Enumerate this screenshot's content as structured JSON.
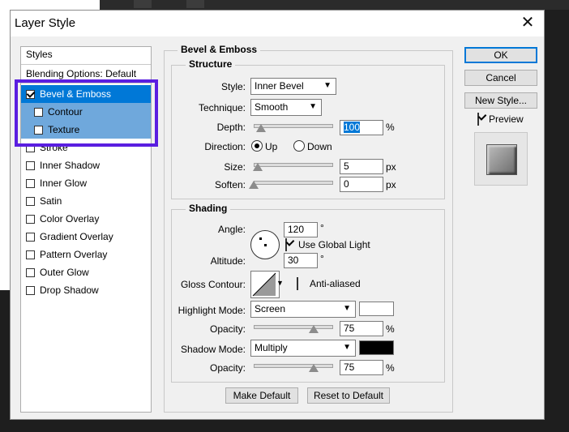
{
  "dialog": {
    "title": "Layer Style",
    "close_glyph": "✕"
  },
  "styles": {
    "header": "Styles",
    "blending": "Blending Options: Default",
    "items": [
      {
        "label": "Bevel & Emboss",
        "checked": true
      },
      {
        "label": "Contour",
        "checked": false
      },
      {
        "label": "Texture",
        "checked": false
      },
      {
        "label": "Stroke",
        "checked": false
      },
      {
        "label": "Inner Shadow",
        "checked": false
      },
      {
        "label": "Inner Glow",
        "checked": false
      },
      {
        "label": "Satin",
        "checked": false
      },
      {
        "label": "Color Overlay",
        "checked": false
      },
      {
        "label": "Gradient Overlay",
        "checked": false
      },
      {
        "label": "Pattern Overlay",
        "checked": false
      },
      {
        "label": "Outer Glow",
        "checked": false
      },
      {
        "label": "Drop Shadow",
        "checked": false
      }
    ]
  },
  "bevel": {
    "section_title": "Bevel & Emboss",
    "structure": {
      "title": "Structure",
      "style_label": "Style:",
      "style_value": "Inner Bevel",
      "technique_label": "Technique:",
      "technique_value": "Smooth",
      "depth_label": "Depth:",
      "depth_value": "100",
      "depth_unit": "%",
      "direction_label": "Direction:",
      "dir_up": "Up",
      "dir_down": "Down",
      "size_label": "Size:",
      "size_value": "5",
      "size_unit": "px",
      "soften_label": "Soften:",
      "soften_value": "0",
      "soften_unit": "px"
    },
    "shading": {
      "title": "Shading",
      "angle_label": "Angle:",
      "angle_value": "120",
      "angle_unit": "°",
      "global_light": "Use Global Light",
      "altitude_label": "Altitude:",
      "altitude_value": "30",
      "altitude_unit": "°",
      "gloss_label": "Gloss Contour:",
      "anti_aliased": "Anti-aliased",
      "highlight_mode_label": "Highlight Mode:",
      "highlight_mode_value": "Screen",
      "highlight_color": "#ffffff",
      "hl_opacity_label": "Opacity:",
      "hl_opacity_value": "75",
      "hl_opacity_unit": "%",
      "shadow_mode_label": "Shadow Mode:",
      "shadow_mode_value": "Multiply",
      "shadow_color": "#000000",
      "sh_opacity_label": "Opacity:",
      "sh_opacity_value": "75",
      "sh_opacity_unit": "%"
    },
    "make_default": "Make Default",
    "reset_default": "Reset to Default"
  },
  "buttons": {
    "ok": "OK",
    "cancel": "Cancel",
    "new_style": "New Style...",
    "preview": "Preview"
  },
  "colors": {
    "accent": "#0078d7",
    "annotation": "#5a1ee0",
    "sub_selected": "#6fa8dc"
  }
}
